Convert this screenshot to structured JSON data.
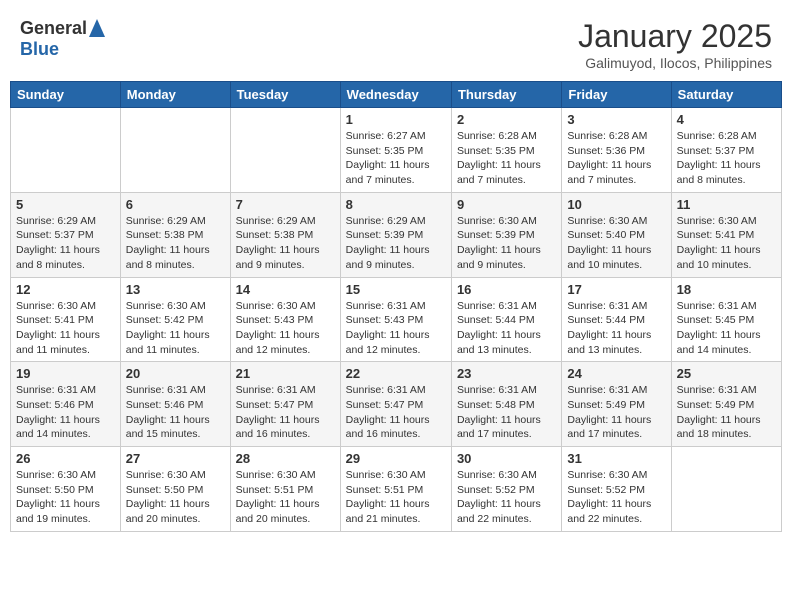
{
  "header": {
    "logo_general": "General",
    "logo_blue": "Blue",
    "month_title": "January 2025",
    "subtitle": "Galimuyod, Ilocos, Philippines"
  },
  "weekdays": [
    "Sunday",
    "Monday",
    "Tuesday",
    "Wednesday",
    "Thursday",
    "Friday",
    "Saturday"
  ],
  "weeks": [
    [
      {
        "day": "",
        "content": ""
      },
      {
        "day": "",
        "content": ""
      },
      {
        "day": "",
        "content": ""
      },
      {
        "day": "1",
        "content": "Sunrise: 6:27 AM\nSunset: 5:35 PM\nDaylight: 11 hours\nand 7 minutes."
      },
      {
        "day": "2",
        "content": "Sunrise: 6:28 AM\nSunset: 5:35 PM\nDaylight: 11 hours\nand 7 minutes."
      },
      {
        "day": "3",
        "content": "Sunrise: 6:28 AM\nSunset: 5:36 PM\nDaylight: 11 hours\nand 7 minutes."
      },
      {
        "day": "4",
        "content": "Sunrise: 6:28 AM\nSunset: 5:37 PM\nDaylight: 11 hours\nand 8 minutes."
      }
    ],
    [
      {
        "day": "5",
        "content": "Sunrise: 6:29 AM\nSunset: 5:37 PM\nDaylight: 11 hours\nand 8 minutes."
      },
      {
        "day": "6",
        "content": "Sunrise: 6:29 AM\nSunset: 5:38 PM\nDaylight: 11 hours\nand 8 minutes."
      },
      {
        "day": "7",
        "content": "Sunrise: 6:29 AM\nSunset: 5:38 PM\nDaylight: 11 hours\nand 9 minutes."
      },
      {
        "day": "8",
        "content": "Sunrise: 6:29 AM\nSunset: 5:39 PM\nDaylight: 11 hours\nand 9 minutes."
      },
      {
        "day": "9",
        "content": "Sunrise: 6:30 AM\nSunset: 5:39 PM\nDaylight: 11 hours\nand 9 minutes."
      },
      {
        "day": "10",
        "content": "Sunrise: 6:30 AM\nSunset: 5:40 PM\nDaylight: 11 hours\nand 10 minutes."
      },
      {
        "day": "11",
        "content": "Sunrise: 6:30 AM\nSunset: 5:41 PM\nDaylight: 11 hours\nand 10 minutes."
      }
    ],
    [
      {
        "day": "12",
        "content": "Sunrise: 6:30 AM\nSunset: 5:41 PM\nDaylight: 11 hours\nand 11 minutes."
      },
      {
        "day": "13",
        "content": "Sunrise: 6:30 AM\nSunset: 5:42 PM\nDaylight: 11 hours\nand 11 minutes."
      },
      {
        "day": "14",
        "content": "Sunrise: 6:30 AM\nSunset: 5:43 PM\nDaylight: 11 hours\nand 12 minutes."
      },
      {
        "day": "15",
        "content": "Sunrise: 6:31 AM\nSunset: 5:43 PM\nDaylight: 11 hours\nand 12 minutes."
      },
      {
        "day": "16",
        "content": "Sunrise: 6:31 AM\nSunset: 5:44 PM\nDaylight: 11 hours\nand 13 minutes."
      },
      {
        "day": "17",
        "content": "Sunrise: 6:31 AM\nSunset: 5:44 PM\nDaylight: 11 hours\nand 13 minutes."
      },
      {
        "day": "18",
        "content": "Sunrise: 6:31 AM\nSunset: 5:45 PM\nDaylight: 11 hours\nand 14 minutes."
      }
    ],
    [
      {
        "day": "19",
        "content": "Sunrise: 6:31 AM\nSunset: 5:46 PM\nDaylight: 11 hours\nand 14 minutes."
      },
      {
        "day": "20",
        "content": "Sunrise: 6:31 AM\nSunset: 5:46 PM\nDaylight: 11 hours\nand 15 minutes."
      },
      {
        "day": "21",
        "content": "Sunrise: 6:31 AM\nSunset: 5:47 PM\nDaylight: 11 hours\nand 16 minutes."
      },
      {
        "day": "22",
        "content": "Sunrise: 6:31 AM\nSunset: 5:47 PM\nDaylight: 11 hours\nand 16 minutes."
      },
      {
        "day": "23",
        "content": "Sunrise: 6:31 AM\nSunset: 5:48 PM\nDaylight: 11 hours\nand 17 minutes."
      },
      {
        "day": "24",
        "content": "Sunrise: 6:31 AM\nSunset: 5:49 PM\nDaylight: 11 hours\nand 17 minutes."
      },
      {
        "day": "25",
        "content": "Sunrise: 6:31 AM\nSunset: 5:49 PM\nDaylight: 11 hours\nand 18 minutes."
      }
    ],
    [
      {
        "day": "26",
        "content": "Sunrise: 6:30 AM\nSunset: 5:50 PM\nDaylight: 11 hours\nand 19 minutes."
      },
      {
        "day": "27",
        "content": "Sunrise: 6:30 AM\nSunset: 5:50 PM\nDaylight: 11 hours\nand 20 minutes."
      },
      {
        "day": "28",
        "content": "Sunrise: 6:30 AM\nSunset: 5:51 PM\nDaylight: 11 hours\nand 20 minutes."
      },
      {
        "day": "29",
        "content": "Sunrise: 6:30 AM\nSunset: 5:51 PM\nDaylight: 11 hours\nand 21 minutes."
      },
      {
        "day": "30",
        "content": "Sunrise: 6:30 AM\nSunset: 5:52 PM\nDaylight: 11 hours\nand 22 minutes."
      },
      {
        "day": "31",
        "content": "Sunrise: 6:30 AM\nSunset: 5:52 PM\nDaylight: 11 hours\nand 22 minutes."
      },
      {
        "day": "",
        "content": ""
      }
    ]
  ]
}
